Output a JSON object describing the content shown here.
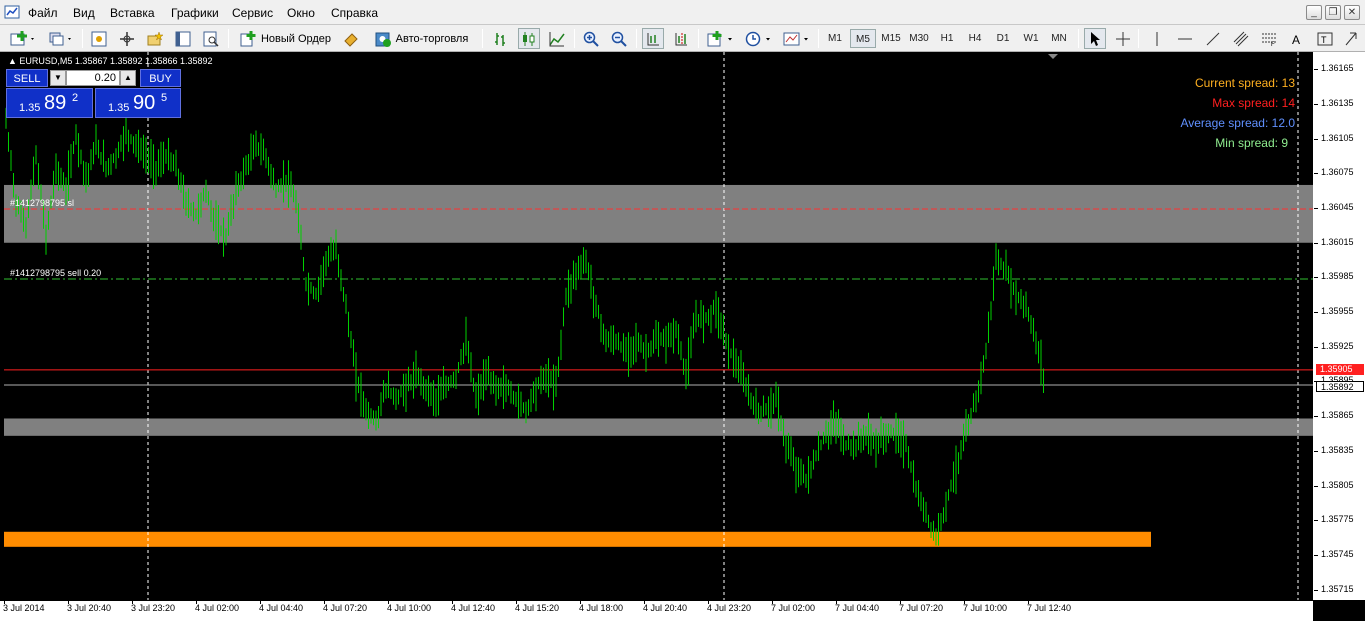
{
  "menu": {
    "items": [
      "Файл",
      "Вид",
      "Вставка",
      "Графики",
      "Сервис",
      "Окно",
      "Справка"
    ]
  },
  "toolbar": {
    "new_order_label": "Новый Ордер",
    "autotrading_label": "Авто-торговля",
    "timeframes": [
      "M1",
      "M5",
      "M15",
      "M30",
      "H1",
      "H4",
      "D1",
      "W1",
      "MN"
    ],
    "active_timeframe": "M5"
  },
  "chart": {
    "symbol_info": "EURUSD,M5  1.35867 1.35892 1.35866 1.35892",
    "background": "#000000",
    "candle_color": "#00d000"
  },
  "one_click": {
    "sell_label": "SELL",
    "buy_label": "BUY",
    "lot": "0.20",
    "sell_price": {
      "prefix": "1.35",
      "big": "89",
      "sup": "2"
    },
    "buy_price": {
      "prefix": "1.35",
      "big": "90",
      "sup": "5"
    }
  },
  "spread": {
    "current": "Current spread: 13",
    "max": "Max spread: 14",
    "average": "Average spread: 12.0",
    "min": "Min spread: 9",
    "colors": {
      "current": "#ffb020",
      "max": "#ff2020",
      "average": "#6090ff",
      "min": "#90ee90"
    }
  },
  "orders": {
    "sl_label": "#1412798795 sl",
    "entry_label": "#1412798795 sell 0.20"
  },
  "price_axis": {
    "labels": [
      "1.36165",
      "1.36135",
      "1.36105",
      "1.36075",
      "1.36045",
      "1.36015",
      "1.35985",
      "1.35955",
      "1.35925",
      "1.35895",
      "1.35865",
      "1.35835",
      "1.35805",
      "1.35775",
      "1.35745",
      "1.35715"
    ],
    "ask_tag": "1.35905",
    "bid_tag": "1.35892"
  },
  "time_axis": {
    "labels": [
      "3 Jul 2014",
      "3 Jul 20:40",
      "3 Jul 23:20",
      "4 Jul 02:00",
      "4 Jul 04:40",
      "4 Jul 07:20",
      "4 Jul 10:00",
      "4 Jul 12:40",
      "4 Jul 15:20",
      "4 Jul 18:00",
      "4 Jul 20:40",
      "4 Jul 23:20",
      "7 Jul 02:00",
      "7 Jul 04:40",
      "7 Jul 07:20",
      "7 Jul 10:00",
      "7 Jul 12:40"
    ]
  },
  "zones": [
    {
      "from": 1.36015,
      "to": 1.36065,
      "color": "#808080"
    },
    {
      "from": 1.35848,
      "to": 1.35863,
      "color": "#808080"
    },
    {
      "from": 1.35752,
      "to": 1.35765,
      "color": "#ff8c00"
    }
  ],
  "chart_data": {
    "type": "line",
    "y_range": [
      1.35706,
      1.3618
    ],
    "series": [
      {
        "values": [
          1.3612,
          1.3605,
          1.3603,
          1.3609,
          1.3602,
          1.3608,
          1.3606,
          1.3611,
          1.3607,
          1.361,
          1.3608,
          1.3609,
          1.3611,
          1.361,
          1.3609,
          1.3608,
          1.3609,
          1.3608,
          1.3605,
          1.3604,
          1.3606,
          1.3603,
          1.3602,
          1.3606,
          1.3608,
          1.361,
          1.3609,
          1.3606,
          1.3607,
          1.3605,
          1.3598,
          1.3597,
          1.36,
          1.3601,
          1.3596,
          1.359,
          1.3587,
          1.3586,
          1.3589,
          1.3588,
          1.3589,
          1.359,
          1.3589,
          1.3588,
          1.3589,
          1.359,
          1.3593,
          1.3588,
          1.359,
          1.3589,
          1.3589,
          1.3588,
          1.3587,
          1.3589,
          1.359,
          1.3589,
          1.3597,
          1.3599,
          1.36,
          1.3596,
          1.3593,
          1.3593,
          1.3592,
          1.3593,
          1.3592,
          1.3593,
          1.3593,
          1.3594,
          1.359,
          1.3595,
          1.3595,
          1.3596,
          1.3593,
          1.3591,
          1.3589,
          1.3587,
          1.3587,
          1.3588,
          1.3584,
          1.3582,
          1.3581,
          1.3583,
          1.3585,
          1.3586,
          1.3584,
          1.3584,
          1.3585,
          1.3584,
          1.3585,
          1.3585,
          1.3584,
          1.358,
          1.3578,
          1.3576,
          1.3579,
          1.3582,
          1.3585,
          1.3588,
          1.3592,
          1.36,
          1.3599,
          1.3597,
          1.3596,
          1.3593,
          1.3589
        ]
      }
    ]
  }
}
